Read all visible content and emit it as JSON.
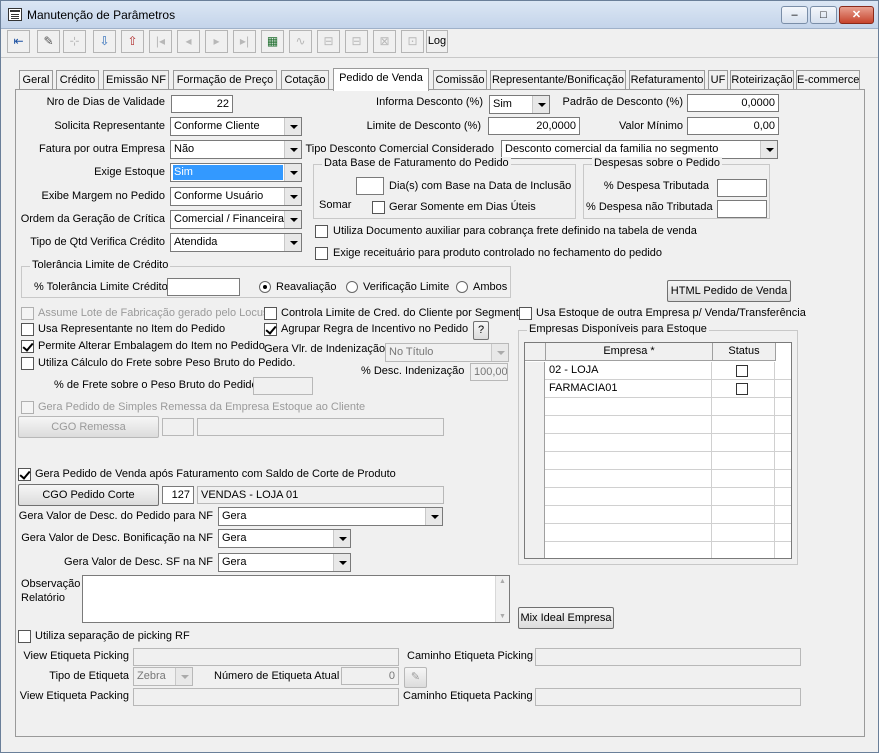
{
  "window": {
    "title": "Manutenção de Parâmetros"
  },
  "toolbar": {
    "log_label": "Log"
  },
  "tabs": [
    "Geral",
    "Crédito",
    "Emissão NF",
    "Formação de Preço",
    "Cotação",
    "Pedido de Venda",
    "Comissão",
    "Representante/Bonificação",
    "Refaturamento",
    "UF",
    "Roteirização",
    "E-commerce"
  ],
  "active_tab": "Pedido de Venda",
  "form": {
    "nro_dias_validade": {
      "label": "Nro de Dias de Validade",
      "value": "22"
    },
    "solicita_representante": {
      "label": "Solicita Representante",
      "value": "Conforme Cliente"
    },
    "fatura_outra_empresa": {
      "label": "Fatura por outra Empresa",
      "value": "Não"
    },
    "exige_estoque": {
      "label": "Exige Estoque",
      "value": "Sim"
    },
    "exibe_margem": {
      "label": "Exibe Margem no Pedido",
      "value": "Conforme Usuário"
    },
    "ordem_critica": {
      "label": "Ordem da Geração de Crítica",
      "value": "Comercial / Financeira"
    },
    "tipo_qtd": {
      "label": "Tipo de Qtd Verifica Crédito",
      "value": "Atendida"
    },
    "informa_desconto": {
      "label": "Informa Desconto (%)",
      "value": "Sim"
    },
    "padrao_desconto": {
      "label": "Padrão de Desconto (%)",
      "value": "0,0000"
    },
    "limite_desconto": {
      "label": "Limite de Desconto (%)",
      "value": "20,0000"
    },
    "valor_minimo": {
      "label": "Valor Mínimo",
      "value": "0,00"
    },
    "tipo_desconto": {
      "label": "Tipo Desconto Comercial Considerado",
      "value": "Desconto comercial da familia no segmento"
    }
  },
  "data_base": {
    "title": "Data Base de Faturamento do Pedido",
    "somar": "Somar",
    "dias_label": "Dia(s)  com Base na Data de Inclusão",
    "dias_uteis": "Gerar Somente em Dias Úteis"
  },
  "despesas": {
    "title": "Despesas sobre o Pedido",
    "tributada": "% Despesa Tributada",
    "nao_tributada": "% Despesa não Tributada"
  },
  "utiliza_doc_auxiliar": "Utiliza Documento auxiliar para cobrança frete definido na tabela de venda",
  "exige_receituario": "Exige receituário para produto controlado no fechamento do pedido",
  "tolerancia": {
    "title": "Tolerância Limite de Crédito",
    "label": "% Tolerância Limite Crédito",
    "reavaliacao": "Reavaliação",
    "verificacao": "Verificação Limite",
    "ambos": "Ambos"
  },
  "html_pedido": "HTML Pedido de Venda",
  "checks": {
    "assume_lote": "Assume Lote de Fabricação gerado pelo Locus",
    "controla_limite": "Controla Limite de Cred. do Cliente por Segmento",
    "usa_estoque_outra": "Usa Estoque de outra Empresa p/ Venda/Transferência",
    "usa_representante": "Usa Representante no Item do Pedido",
    "agrupar_regra": "Agrupar Regra de Incentivo no Pedido",
    "help": "?",
    "permite_alterar": "Permite Alterar Embalagem do Item no Pedido",
    "utiliza_calculo": "Utiliza Cálculo do Frete sobre Peso Bruto do Pedido."
  },
  "gera_vlr": {
    "label": "Gera Vlr. de Indenização",
    "value": "No Título"
  },
  "desc_indenizacao": {
    "label": "% Desc. Indenização",
    "value": "100,00"
  },
  "frete_peso": "% de Frete sobre o Peso Bruto do Pedido",
  "gera_pedido_simples": "Gera Pedido de Simples Remessa da Empresa Estoque ao Cliente",
  "cgo_remessa": "CGO Remessa",
  "empresas": {
    "title": "Empresas Disponíveis para Estoque",
    "col_empresa": "Empresa *",
    "col_status": "Status",
    "rows": [
      "02 - LOJA",
      "FARMACIA01"
    ]
  },
  "gera_pedido_corte": "Gera Pedido de Venda após Faturamento com Saldo de Corte de Produto",
  "cgo_pedido_corte": {
    "label": "CGO Pedido Corte",
    "code": "127",
    "desc": "VENDAS - LOJA 01"
  },
  "gera_desc_pedido": {
    "label": "Gera Valor de Desc. do Pedido para NF",
    "value": "Gera"
  },
  "gera_desc_bonif": {
    "label": "Gera Valor de Desc. Bonificação na NF",
    "value": "Gera"
  },
  "gera_desc_sf": {
    "label": "Gera Valor de Desc. SF na NF",
    "value": "Gera"
  },
  "observacao": "Observação Relatório",
  "mix_ideal": "Mix Ideal Empresa",
  "picking": {
    "utiliza": "Utiliza separação de picking RF",
    "view_picking": "View Etiqueta Picking",
    "caminho_picking": "Caminho Etiqueta Picking",
    "tipo_etiqueta": "Tipo de Etiqueta",
    "tipo_value": "Zebra",
    "numero_etiqueta": "Número de Etiqueta Atual",
    "numero_value": "0",
    "view_packing": "View Etiqueta Packing",
    "caminho_packing": "Caminho Etiqueta Packing"
  }
}
